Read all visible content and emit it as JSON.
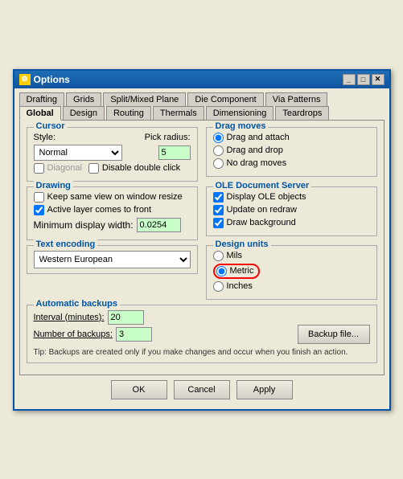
{
  "window": {
    "title": "Options",
    "icon": "⚙"
  },
  "titleButtons": [
    "_",
    "□",
    "✕"
  ],
  "tabs_row1": [
    {
      "label": "Drafting",
      "active": false
    },
    {
      "label": "Grids",
      "active": false
    },
    {
      "label": "Split/Mixed Plane",
      "active": false
    },
    {
      "label": "Die Component",
      "active": false
    },
    {
      "label": "Via Patterns",
      "active": false
    }
  ],
  "tabs_row2": [
    {
      "label": "Global",
      "active": true
    },
    {
      "label": "Design",
      "active": false
    },
    {
      "label": "Routing",
      "active": false
    },
    {
      "label": "Thermals",
      "active": false
    },
    {
      "label": "Dimensioning",
      "active": false
    },
    {
      "label": "Teardrops",
      "active": false
    }
  ],
  "cursor": {
    "label": "Cursor",
    "style_label": "Style:",
    "style_value": "Normal",
    "pick_radius_label": "Pick radius:",
    "pick_radius_value": "5",
    "diagonal_label": "Diagonal",
    "disable_dbl_click_label": "Disable double click"
  },
  "drag_moves": {
    "label": "Drag moves",
    "options": [
      {
        "label": "Drag and attach",
        "selected": true
      },
      {
        "label": "Drag and drop",
        "selected": false
      },
      {
        "label": "No drag moves",
        "selected": false
      }
    ]
  },
  "drawing": {
    "label": "Drawing",
    "items": [
      {
        "label": "Keep same view on window resize",
        "checked": false
      },
      {
        "label": "Active layer comes to front",
        "checked": true
      },
      {
        "label": "Minimum display width:",
        "value": "0.0254"
      }
    ]
  },
  "ole": {
    "label": "OLE Document Server",
    "items": [
      {
        "label": "Display OLE objects",
        "checked": true
      },
      {
        "label": "Update on redraw",
        "checked": true
      },
      {
        "label": "Draw background",
        "checked": true
      }
    ]
  },
  "text_encoding": {
    "label": "Text encoding",
    "value": "Western European"
  },
  "design_units": {
    "label": "Design units",
    "options": [
      {
        "label": "Mils",
        "selected": false
      },
      {
        "label": "Metric",
        "selected": true
      },
      {
        "label": "Inches",
        "selected": false
      }
    ]
  },
  "auto_backups": {
    "label": "Automatic backups",
    "interval_label": "Interval (minutes):",
    "interval_value": "20",
    "num_backups_label": "Number of backups:",
    "num_backups_value": "3",
    "backup_btn_label": "Backup file...",
    "tip": "Tip: Backups are created only if you make changes and occur when you finish an action."
  },
  "buttons": {
    "ok": "OK",
    "cancel": "Cancel",
    "apply": "Apply"
  }
}
